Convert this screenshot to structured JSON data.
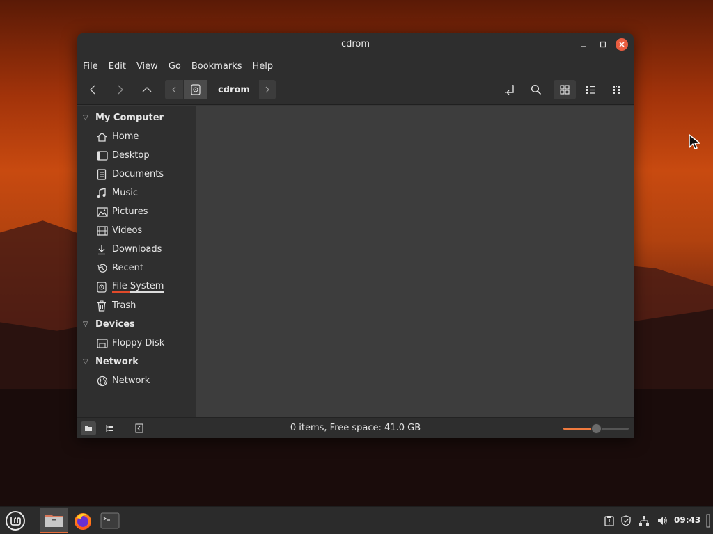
{
  "window": {
    "title": "cdrom",
    "minimize_label": "–",
    "maximize_label": "□",
    "close_label": "✕"
  },
  "menubar": [
    "File",
    "Edit",
    "View",
    "Go",
    "Bookmarks",
    "Help"
  ],
  "toolbar": {
    "back_icon": "‹",
    "forward_icon": "›",
    "up_icon": "︿",
    "breadcrumb_left": "‹",
    "breadcrumb_right": "›",
    "breadcrumb_current": "cdrom"
  },
  "sidebar": {
    "sections": [
      {
        "title": "My Computer",
        "items": [
          {
            "label": "Home",
            "icon": "home-icon"
          },
          {
            "label": "Desktop",
            "icon": "desktop-icon"
          },
          {
            "label": "Documents",
            "icon": "documents-icon"
          },
          {
            "label": "Music",
            "icon": "music-icon"
          },
          {
            "label": "Pictures",
            "icon": "pictures-icon"
          },
          {
            "label": "Videos",
            "icon": "videos-icon"
          },
          {
            "label": "Downloads",
            "icon": "downloads-icon"
          },
          {
            "label": "Recent",
            "icon": "recent-icon"
          },
          {
            "label": "File System",
            "icon": "filesystem-icon"
          },
          {
            "label": "Trash",
            "icon": "trash-icon"
          }
        ]
      },
      {
        "title": "Devices",
        "items": [
          {
            "label": "Floppy Disk",
            "icon": "floppy-icon"
          }
        ]
      },
      {
        "title": "Network",
        "items": [
          {
            "label": "Network",
            "icon": "network-icon"
          }
        ]
      }
    ]
  },
  "status": {
    "text": "0 items, Free space: 41.0 GB",
    "zoom_fraction": 0.5
  },
  "taskbar": {
    "clock": "09:43"
  },
  "colors": {
    "accent": "#f07a3e",
    "close_button": "#e95d40",
    "window_bg": "#2e2e2e",
    "content_bg": "#3d3d3d"
  }
}
